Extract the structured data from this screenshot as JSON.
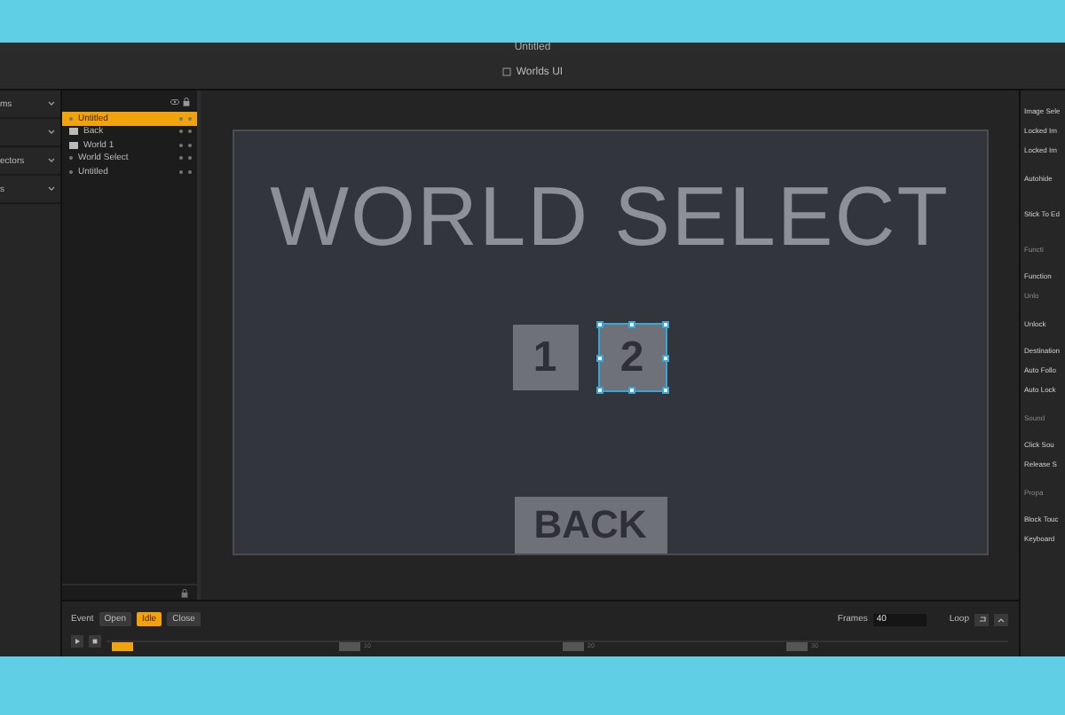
{
  "window": {
    "title": "Untitled",
    "document": "Worlds UI"
  },
  "left_panel": [
    {
      "label": "ms",
      "expanded": false
    },
    {
      "expanded": false
    },
    {
      "label": "ectors",
      "expanded": false
    },
    {
      "label": "s",
      "expanded": false
    }
  ],
  "hierarchy": [
    {
      "label": "Untitled",
      "kind": "dot",
      "selected": true
    },
    {
      "label": "Back",
      "kind": "image",
      "selected": false
    },
    {
      "label": "World 1",
      "kind": "image",
      "selected": false
    },
    {
      "label": "World Select",
      "kind": "dot",
      "selected": false
    },
    {
      "label": "Untitled",
      "kind": "dot",
      "selected": false
    }
  ],
  "stage": {
    "title": "WORLD SELECT",
    "buttons": [
      {
        "label": "1",
        "selected": false
      },
      {
        "label": "2",
        "selected": true
      }
    ],
    "back": {
      "label": "BACK",
      "selected": false
    }
  },
  "timeline": {
    "event_label": "Event",
    "events": [
      {
        "label": "Open",
        "selected": false
      },
      {
        "label": "Idle",
        "selected": true
      },
      {
        "label": "Close",
        "selected": false
      }
    ],
    "frames_label": "Frames",
    "frames": "40",
    "loop_label": "Loop",
    "markers": [
      {
        "label": "10"
      },
      {
        "label": "20"
      },
      {
        "label": "30"
      }
    ]
  },
  "inspector": [
    {
      "label": "Image Sele",
      "disabled": false
    },
    {
      "label": "Locked Im",
      "disabled": false
    },
    {
      "label": "Locked Im",
      "disabled": false
    },
    {
      "label": "Autohide",
      "disabled": false
    },
    {
      "label": "Stick To Ed",
      "disabled": false
    },
    {
      "label": "Functi",
      "disabled": true
    },
    {
      "label": "Function",
      "disabled": false
    },
    {
      "label": "Unlo",
      "disabled": true
    },
    {
      "label": "Unlock",
      "disabled": false
    },
    {
      "label": "Destination",
      "disabled": false
    },
    {
      "label": "Auto Follo",
      "disabled": false
    },
    {
      "label": "Auto Lock",
      "disabled": false
    },
    {
      "label": "Sound",
      "disabled": true
    },
    {
      "label": "Click Sou",
      "disabled": false
    },
    {
      "label": "Release S",
      "disabled": false
    },
    {
      "label": "Propa",
      "disabled": true
    },
    {
      "label": "Block Touc",
      "disabled": false
    },
    {
      "label": "Keyboard",
      "disabled": false
    }
  ]
}
